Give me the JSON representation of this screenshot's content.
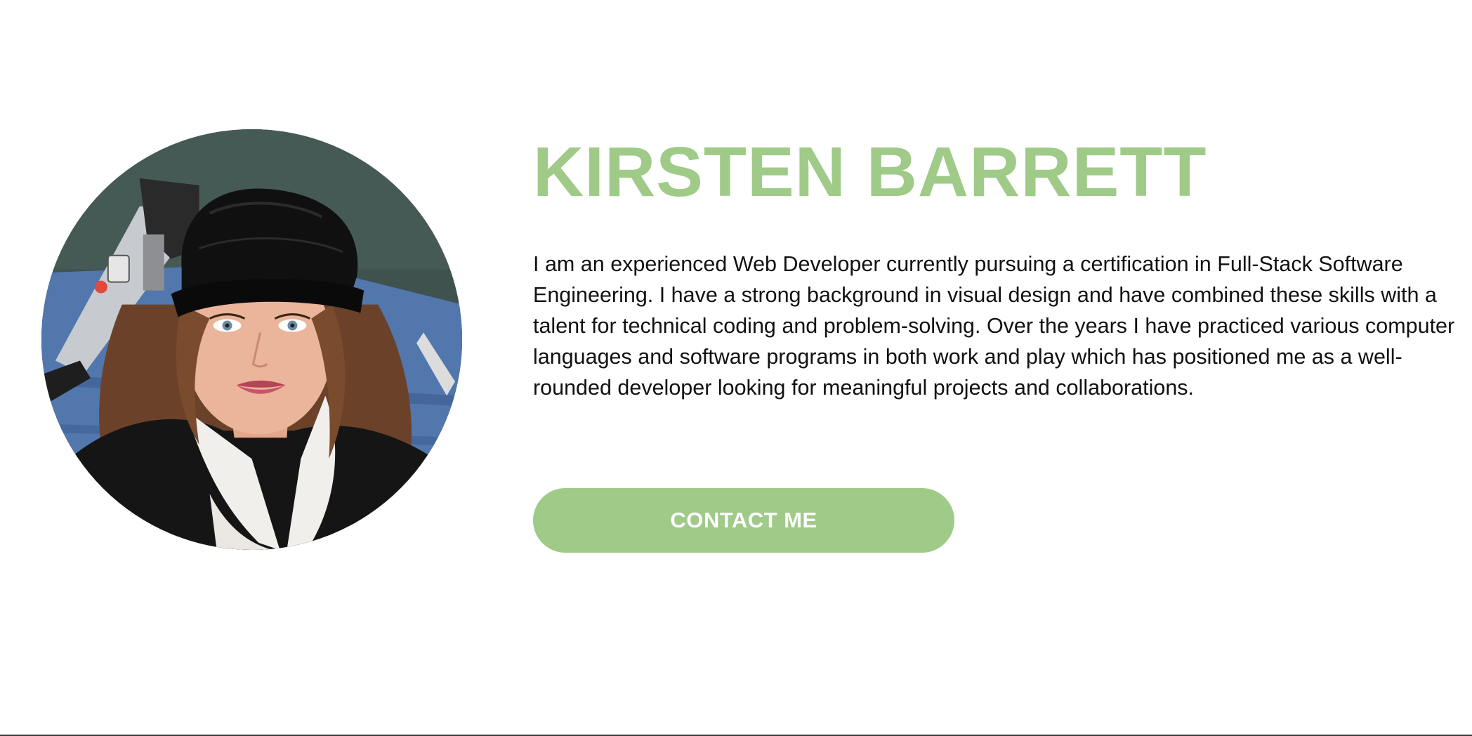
{
  "profile": {
    "name": "KIRSTEN BARRETT",
    "bio": "I am an experienced Web Developer currently pursuing a certification in Full-Stack Software Engineering. I have a strong background in visual design and have combined these skills with a talent for technical coding and problem-solving. Over the years I have practiced various computer languages and software programs in both work and play which has positioned me as a well-rounded developer looking for meaningful projects and collaborations.",
    "contact_label": "CONTACT ME"
  },
  "colors": {
    "accent": "#9fca88",
    "text": "#111111",
    "background": "#ffffff"
  },
  "icons": {
    "portrait": "profile-photo"
  }
}
